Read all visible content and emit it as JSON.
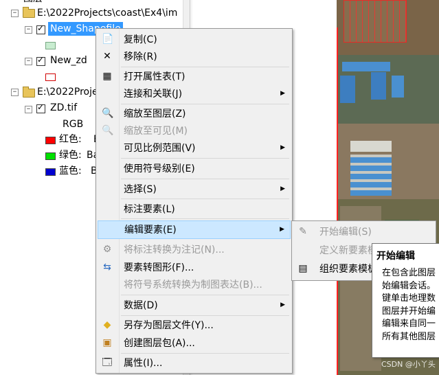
{
  "toc": {
    "top_partial": "图层",
    "folder1": {
      "label": "E:\\2022Projects\\coast\\Ex4\\im"
    },
    "layer_new_shapefile": {
      "label": "New_Shapefile"
    },
    "layer_new_zd": {
      "label": "New_zd"
    },
    "folder2": {
      "label": "E:\\2022Proje"
    },
    "layer_zd": {
      "label": "ZD.tif"
    },
    "rgb_label": "RGB",
    "bands": [
      {
        "label": "红色:",
        "value": "B",
        "color": "#ff0000"
      },
      {
        "label": "绿色:",
        "value": "Ba",
        "color": "#00e000"
      },
      {
        "label": "蓝色:",
        "value": "B",
        "color": "#0000d0"
      }
    ]
  },
  "menu": {
    "copy": "复制(C)",
    "remove": "移除(R)",
    "open_attr": "打开属性表(T)",
    "joins": "连接和关联(J)",
    "zoom_layer": "缩放至图层(Z)",
    "zoom_visible": "缩放至可见(M)",
    "visible_scale": "可见比例范围(V)",
    "symbol_levels": "使用符号级别(E)",
    "selection": "选择(S)",
    "label_features": "标注要素(L)",
    "edit_features": "编辑要素(E)",
    "convert_labels": "将标注转换为注记(N)...",
    "features_to_graphics": "要素转图形(F)...",
    "convert_symbology": "将符号系统转换为制图表达(B)...",
    "data": "数据(D)",
    "save_layer": "另存为图层文件(Y)...",
    "create_package": "创建图层包(A)...",
    "properties": "属性(I)..."
  },
  "submenu": {
    "start_editing": "开始编辑(S)",
    "define_templates": "定义新要素模",
    "organize_templates": "组织要素模板"
  },
  "tooltip": {
    "title": "开始编辑",
    "body": "在包含此图层\n始编辑会话。\n键单击地理数\n图层并开始编\n编辑来自同一\n所有其他图层"
  },
  "watermark": "CSDN @小丫头"
}
